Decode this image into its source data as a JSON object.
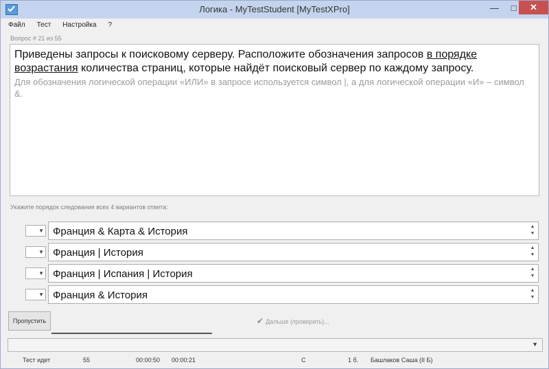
{
  "window": {
    "title": "Логика - MyTestStudent [MyTestXPro]",
    "minimize": "—",
    "maximize": "□",
    "close": "✕"
  },
  "menu": [
    "Файл",
    "Тест",
    "Настройка",
    "?"
  ],
  "question": {
    "number": "Вопрос # 21 из 55",
    "text_before": "Приведены запросы к поисковому серверу. Расположите обозначения запросов ",
    "text_underlined": "в порядке возрастания",
    "text_after": " количества страниц, которые найдёт поисковый сервер по каждому запросу.",
    "note": "Для обозначения логической операции «ИЛИ» в запросе используется символ |, а для логической операции «И» – символ &."
  },
  "instruction": "Укажите порядок следования всех 4 вариантов ответа:",
  "answers": [
    "Франция & Карта & История",
    "Франция | История",
    "Франция | Испания | История",
    "Франция & История"
  ],
  "buttons": {
    "skip": "Пропустить",
    "next": "Дальше (проверить)..."
  },
  "status": {
    "state": "Тест идет",
    "count": "55",
    "time_total": "00:00:50",
    "time_question": "00:00:21",
    "grade_letter": "С",
    "score": "1 б.",
    "student": "Башлаков Саша (II Б)"
  }
}
